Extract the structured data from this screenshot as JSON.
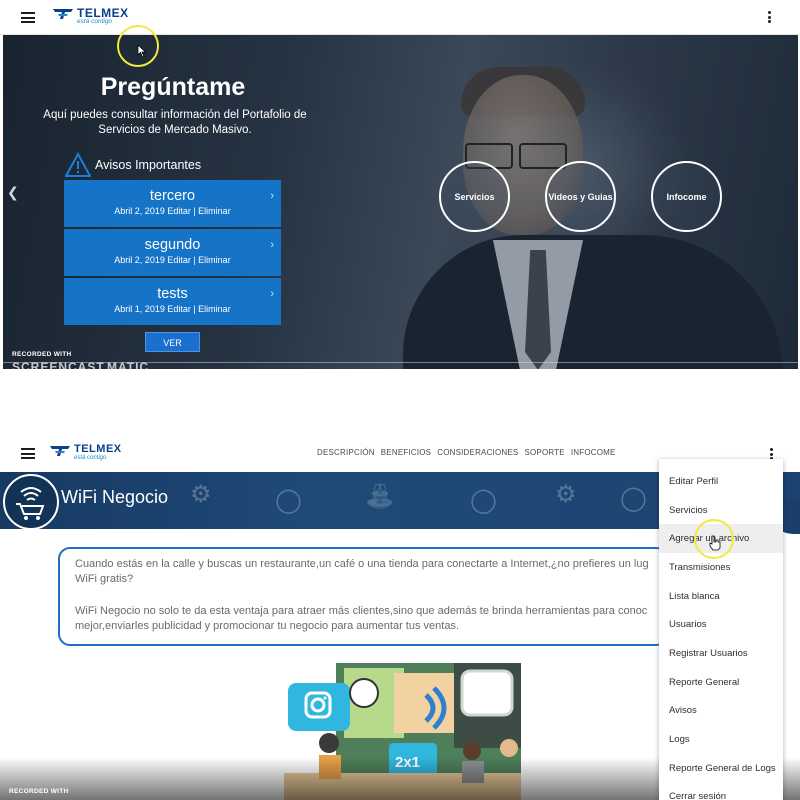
{
  "top": {
    "brand": {
      "name": "TELMEX",
      "tagline": "está contigo"
    },
    "hero": {
      "title": "Pregúntame",
      "description": "Aquí puedes consultar información del Portafolio de Servicios de Mercado Masivo.",
      "avisos_heading": "Avisos Importantes",
      "avisos": [
        {
          "title": "tercero",
          "meta": "Abril 2, 2019 Editar | Eliminar"
        },
        {
          "title": "segundo",
          "meta": "Abril 2, 2019 Editar | Eliminar"
        },
        {
          "title": "tests",
          "meta": "Abril 1, 2019 Editar | Eliminar"
        }
      ],
      "ver_label": "VER",
      "circles": [
        "Servicios",
        "Videos y Guias",
        "Infocome"
      ]
    },
    "watermark": {
      "line1": "RECORDED WITH",
      "line2": "SCREENCAST",
      "line3": "MATIC"
    }
  },
  "bottom": {
    "brand": {
      "name": "TELMEX",
      "tagline": "está contigo"
    },
    "nav_links": [
      "DESCRIPCIÓN",
      "BENEFICIOS",
      "CONSIDERACIONES",
      "SOPORTE",
      "INFOCOME"
    ],
    "banner_title": "WiFi Negocio",
    "info_paragraphs": [
      "Cuando estás en la calle y buscas un restaurante,un café o una tienda para conectarte a Internet,¿no prefieres un lug",
      "WiFi gratis?",
      "WiFi Negocio no solo te da esta ventaja para atraer más clientes,sino que además te brinda herramientas para conoc",
      "mejor,enviarles publicidad y promocionar tu negocio para aumentar tus ventas."
    ],
    "illustration_text": "2x1",
    "menu_items": [
      "Editar Perfil",
      "Servicios",
      "Agregar un archivo",
      "Transmisiones",
      "Lista blanca",
      "Usuarios",
      "Registrar Usuarios",
      "Reporte General",
      "Avisos",
      "Logs",
      "Reporte General de Logs",
      "Cerrar sesión"
    ],
    "menu_highlighted": "Agregar un archivo",
    "watermark": {
      "line1": "RECORDED WITH"
    }
  },
  "colors": {
    "brand_blue": "#0b3f8a",
    "card_blue": "#1574c8",
    "banner_navy": "#1f4a78",
    "info_border": "#1e6fc2",
    "cursor_ring": "#f2ea3a"
  }
}
